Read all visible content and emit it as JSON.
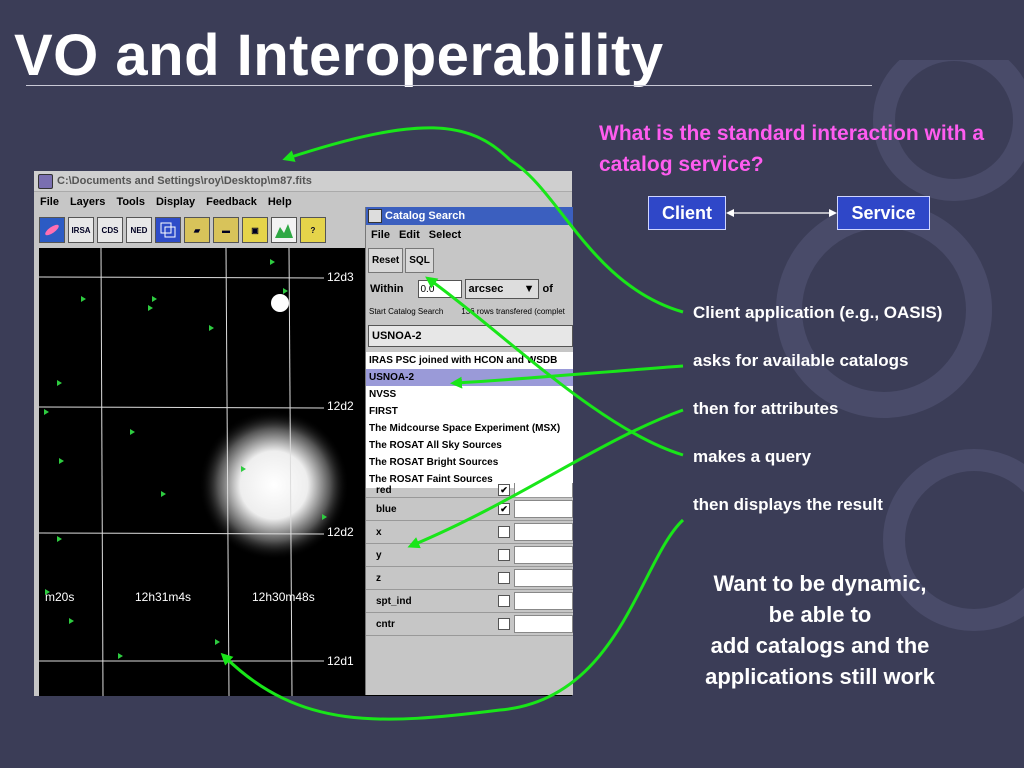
{
  "slide": {
    "title": "VO and Interoperability",
    "question": "What is the standard interaction with a catalog service?",
    "client_label": "Client",
    "service_label": "Service",
    "steps": [
      "Client application (e.g., OASIS)",
      "asks for available catalogs",
      "then for attributes",
      "makes a query",
      "then displays the result"
    ],
    "dynamic_note": [
      "Want to be dynamic,",
      "be able to",
      "add catalogs and the",
      "applications still work"
    ],
    "arrow_color": "#19e619",
    "accent_color": "#ff5cf0"
  },
  "app_window": {
    "title": "C:\\Documents and Settings\\roy\\Desktop\\m87.fits",
    "menu": [
      "File",
      "Layers",
      "Tools",
      "Display",
      "Feedback",
      "Help"
    ],
    "toolbar_icons": [
      "galaxy-icon",
      "IRSA",
      "CDS",
      "NED",
      "layers-icon",
      "open-folder-icon",
      "folder-icon",
      "frame-icon",
      "histogram-icon",
      "help-icon"
    ],
    "grid_labels": [
      "12d3",
      "12d2",
      "12d2",
      "12d1",
      "m20s",
      "12h31m4s",
      "12h30m48s"
    ]
  },
  "catalog_window": {
    "title": "Catalog Search",
    "menu": [
      "File",
      "Edit",
      "Select"
    ],
    "buttons": [
      "Reset",
      "SQL"
    ],
    "within_label": "Within",
    "within_value": "0.0",
    "unit": "arcsec",
    "of_label": "of",
    "status_left": "Start  Catalog Search",
    "status_right": "136 rows transfered (complet",
    "selected_catalog": "USNOA-2",
    "catalogs": [
      "IRAS PSC joined with HCON and WSDB",
      "USNOA-2",
      "NVSS",
      "FIRST",
      "The Midcourse Space Experiment (MSX)",
      "The ROSAT All Sky Sources",
      "The ROSAT Bright Sources",
      "The ROSAT Faint Sources"
    ],
    "attributes": [
      {
        "name": "red",
        "checked": true
      },
      {
        "name": "blue",
        "checked": true
      },
      {
        "name": "x",
        "checked": false
      },
      {
        "name": "y",
        "checked": false
      },
      {
        "name": "z",
        "checked": false
      },
      {
        "name": "spt_ind",
        "checked": false
      },
      {
        "name": "cntr",
        "checked": false
      }
    ]
  }
}
